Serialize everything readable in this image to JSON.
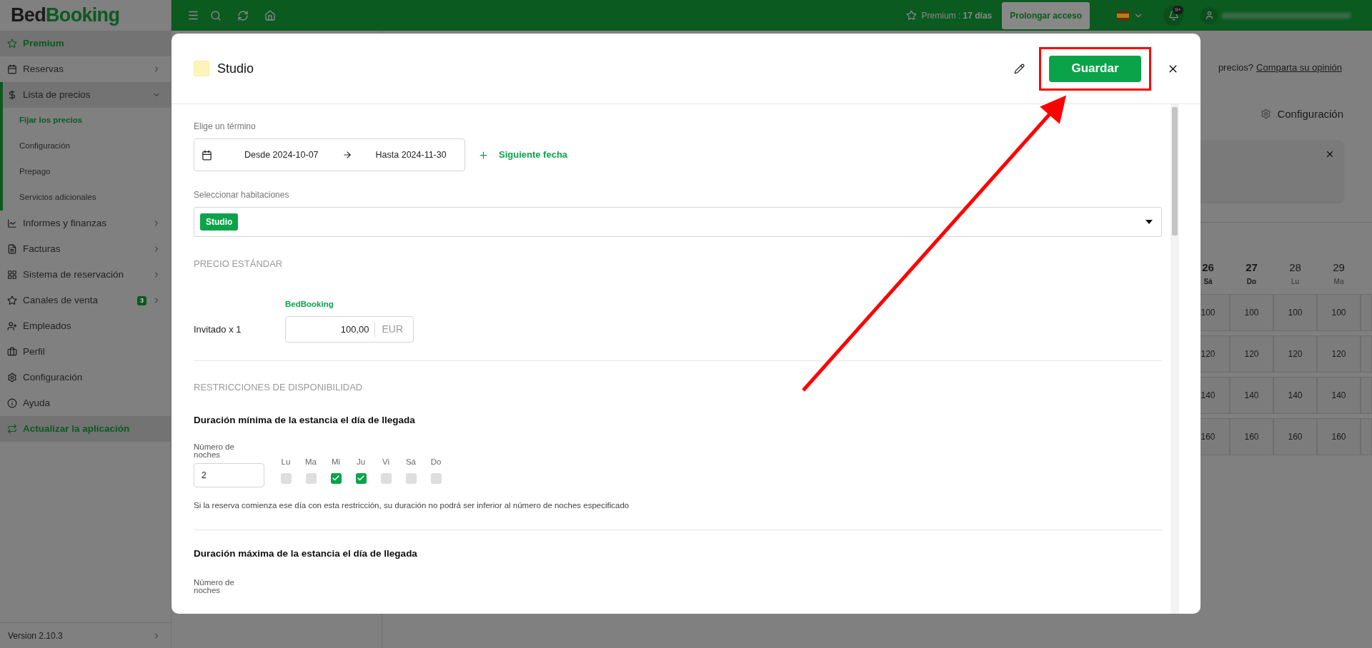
{
  "logo": {
    "part_1": "Bed",
    "part_2": "Booking"
  },
  "sidebar": {
    "items": [
      {
        "kind": "accent",
        "label": "Premium"
      },
      {
        "kind": "menu",
        "label": "Reservas",
        "expanded": false
      },
      {
        "kind": "menu",
        "label": "Lista de precios",
        "expanded": true,
        "children": [
          {
            "label": "Fijar los precios",
            "selected": true
          },
          {
            "label": "Configuración",
            "selected": false
          },
          {
            "label": "Prepago",
            "selected": false
          },
          {
            "label": "Servicios adicionales",
            "selected": false
          }
        ]
      },
      {
        "kind": "menu",
        "label": "Informes y finanzas",
        "expanded": false
      },
      {
        "kind": "menu",
        "label": "Facturas",
        "expanded": false
      },
      {
        "kind": "menu",
        "label": "Sistema de reservación",
        "expanded": false
      },
      {
        "kind": "menu",
        "label": "Canales de venta",
        "expanded": false,
        "badge": "3"
      },
      {
        "kind": "link",
        "label": "Empleados"
      },
      {
        "kind": "link",
        "label": "Perfil"
      },
      {
        "kind": "link",
        "label": "Configuración"
      },
      {
        "kind": "link",
        "label": "Ayuda"
      },
      {
        "kind": "accent",
        "label": "Actualizar la aplicación"
      }
    ],
    "version": "Version 2.10.3"
  },
  "topbar": {
    "premium_label": "Premium :",
    "premium_days": "17 días",
    "extend_button": "Prolongar acceso",
    "notifications_badge": "9+"
  },
  "background": {
    "feedback_question": "precios?",
    "feedback_link": "Comparta su opinión",
    "settings_label": "Configuración",
    "calendar": {
      "days": [
        {
          "day": "26",
          "weekday": "Sá",
          "weekend": true
        },
        {
          "day": "27",
          "weekday": "Do",
          "weekend": true
        },
        {
          "day": "28",
          "weekday": "Lu",
          "weekend": false
        },
        {
          "day": "29",
          "weekday": "Ma",
          "weekend": false
        }
      ],
      "rows": [
        [
          "100",
          "100",
          "100",
          "100"
        ],
        [
          "120",
          "120",
          "120",
          "120"
        ],
        [
          "140",
          "140",
          "140",
          "140"
        ],
        [
          "160",
          "160",
          "160",
          "160"
        ]
      ]
    }
  },
  "modal": {
    "title": "Studio",
    "save_button": "Guardar",
    "period_label": "Elige un término",
    "date_from": "Desde 2024-10-07",
    "date_to": "Hasta 2024-11-30",
    "next_date": "Siguiente fecha",
    "rooms_label": "Seleccionar habitaciones",
    "rooms": [
      "Studio"
    ],
    "standard_price_title": "PRECIO ESTÁNDAR",
    "channel": "BedBooking",
    "guest_label": "Invitado x 1",
    "price": "100,00",
    "currency": "EUR",
    "restrictions_title": "RESTRICCIONES DE DISPONIBILIDAD",
    "min_stay": {
      "title": "Duración mínima de la estancia el día de llegada",
      "nights_label": "Número de noches",
      "nights": "2",
      "days": [
        {
          "label": "Lu",
          "checked": false
        },
        {
          "label": "Ma",
          "checked": false
        },
        {
          "label": "Mi",
          "checked": true
        },
        {
          "label": "Ju",
          "checked": true
        },
        {
          "label": "Vi",
          "checked": false
        },
        {
          "label": "Sá",
          "checked": false
        },
        {
          "label": "Do",
          "checked": false
        }
      ],
      "hint": "Si la reserva comienza ese día con esta restricción, su duración no podrá ser inferior al número de noches especificado"
    },
    "max_stay": {
      "title": "Duración máxima de la estancia el día de llegada",
      "nights_label": "Número de noches"
    }
  }
}
